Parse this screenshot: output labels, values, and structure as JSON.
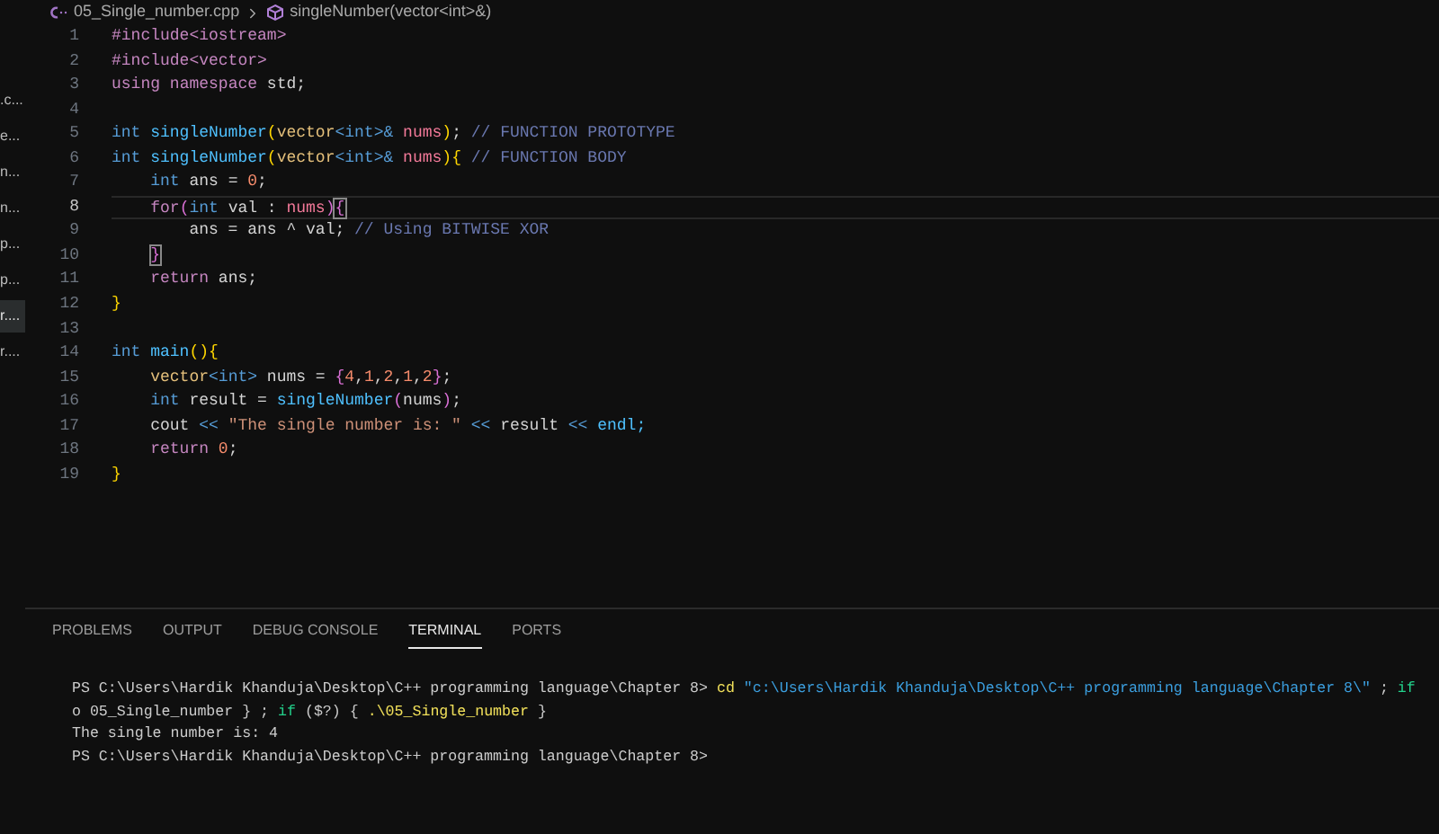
{
  "sidebar": {
    "items": [
      {
        "label": ".c...",
        "selected": false
      },
      {
        "label": "e...",
        "selected": false
      },
      {
        "label": "n...",
        "selected": false
      },
      {
        "label": "n...",
        "selected": false
      },
      {
        "label": "p...",
        "selected": false
      },
      {
        "label": "p...",
        "selected": false
      },
      {
        "label": "r....",
        "selected": true
      },
      {
        "label": "r....",
        "selected": false
      }
    ]
  },
  "breadcrumb": {
    "file": "05_Single_number.cpp",
    "symbol": "singleNumber(vector<int>&)"
  },
  "editor": {
    "lines": [
      {
        "number": "1",
        "current": false,
        "tokens": [
          {
            "text": "#include<iostream>",
            "kind": "preproc"
          }
        ]
      },
      {
        "number": "2",
        "current": false,
        "tokens": [
          {
            "text": "#include<vector>",
            "kind": "preproc"
          }
        ]
      },
      {
        "number": "3",
        "current": false,
        "tokens": [
          {
            "text": "using",
            "kind": "control"
          },
          {
            "text": " namespace",
            "kind": "control"
          },
          {
            "text": " std;",
            "kind": "plain"
          }
        ]
      },
      {
        "number": "4",
        "current": false
      },
      {
        "number": "5",
        "current": false,
        "tokens": [
          {
            "text": "int",
            "kind": "keyword"
          },
          {
            "text": " singleNumber",
            "kind": "func"
          },
          {
            "text": "(",
            "kind": "bracket"
          },
          {
            "text": "vector",
            "kind": "type"
          },
          {
            "text": "<int>&",
            "kind": "keyword"
          },
          {
            "text": " nums",
            "kind": "param"
          },
          {
            "text": ")",
            "kind": "bracket"
          },
          {
            "text": "; ",
            "kind": "plain"
          },
          {
            "text": "// FUNCTION PROTOTYPE",
            "kind": "comment"
          }
        ]
      },
      {
        "number": "6",
        "current": false,
        "tokens": [
          {
            "text": "int",
            "kind": "keyword"
          },
          {
            "text": " singleNumber",
            "kind": "func"
          },
          {
            "text": "(",
            "kind": "bracket"
          },
          {
            "text": "vector",
            "kind": "type"
          },
          {
            "text": "<int>&",
            "kind": "keyword"
          },
          {
            "text": " nums",
            "kind": "param"
          },
          {
            "text": ")",
            "kind": "bracket"
          },
          {
            "text": "{",
            "kind": "bracket"
          },
          {
            "text": " // FUNCTION BODY",
            "kind": "comment"
          }
        ]
      },
      {
        "number": "7",
        "current": false,
        "tokens": [
          {
            "text": "    int",
            "kind": "keyword"
          },
          {
            "text": " ans = ",
            "kind": "plain"
          },
          {
            "text": "0",
            "kind": "number"
          },
          {
            "text": ";",
            "kind": "plain"
          }
        ]
      },
      {
        "number": "8",
        "current": true,
        "tokens": [
          {
            "text": "    for",
            "kind": "control"
          },
          {
            "text": "(",
            "kind": "bracket2"
          },
          {
            "text": "int",
            "kind": "keyword"
          },
          {
            "text": " val : ",
            "kind": "plain"
          },
          {
            "text": "nums",
            "kind": "param"
          },
          {
            "text": ")",
            "kind": "bracket2"
          },
          {
            "text": "{",
            "kind": "match"
          }
        ]
      },
      {
        "number": "9",
        "current": false,
        "tokens": [
          {
            "text": "        ans = ans ^ val; ",
            "kind": "plain"
          },
          {
            "text": "// Using BITWISE XOR",
            "kind": "comment"
          }
        ]
      },
      {
        "number": "10",
        "current": false,
        "tokens": [
          {
            "text": "}",
            "kind": "match"
          }
        ]
      },
      {
        "number": "11",
        "current": false,
        "tokens": [
          {
            "text": "    return",
            "kind": "control"
          },
          {
            "text": " ans;",
            "kind": "plain"
          }
        ]
      },
      {
        "number": "12",
        "current": false,
        "tokens": [
          {
            "text": "}",
            "kind": "bracket"
          }
        ]
      },
      {
        "number": "13",
        "current": false
      },
      {
        "number": "14",
        "current": false,
        "tokens": [
          {
            "text": "int",
            "kind": "keyword"
          },
          {
            "text": " main",
            "kind": "func"
          },
          {
            "text": "(){",
            "kind": "bracket"
          }
        ]
      },
      {
        "number": "15",
        "current": false,
        "tokens": [
          {
            "text": "    vector",
            "kind": "type"
          },
          {
            "text": "<int>",
            "kind": "keyword"
          },
          {
            "text": " nums = ",
            "kind": "plain"
          },
          {
            "text": "{",
            "kind": "bracket2"
          },
          {
            "text": "4",
            "kind": "number"
          },
          {
            "text": ",",
            "kind": "plain"
          },
          {
            "text": "1",
            "kind": "number"
          },
          {
            "text": ",",
            "kind": "plain"
          },
          {
            "text": "2",
            "kind": "number"
          },
          {
            "text": ",",
            "kind": "plain"
          },
          {
            "text": "1",
            "kind": "number"
          },
          {
            "text": ",",
            "kind": "plain"
          },
          {
            "text": "2",
            "kind": "number"
          },
          {
            "text": "}",
            "kind": "bracket2"
          },
          {
            "text": ";",
            "kind": "plain"
          }
        ]
      },
      {
        "number": "16",
        "current": false,
        "tokens": [
          {
            "text": "    int",
            "kind": "keyword"
          },
          {
            "text": " result = ",
            "kind": "plain"
          },
          {
            "text": "singleNumber",
            "kind": "func"
          },
          {
            "text": "(",
            "kind": "bracket2"
          },
          {
            "text": "nums",
            "kind": "plain"
          },
          {
            "text": ")",
            "kind": "bracket2"
          },
          {
            "text": ";",
            "kind": "plain"
          }
        ]
      },
      {
        "number": "17",
        "current": false,
        "tokens": [
          {
            "text": "    cout ",
            "kind": "plain"
          },
          {
            "text": "<<",
            "kind": "keyword"
          },
          {
            "text": " \"The single number is: \" ",
            "kind": "string"
          },
          {
            "text": "<<",
            "kind": "keyword"
          },
          {
            "text": " result ",
            "kind": "plain"
          },
          {
            "text": "<<",
            "kind": "keyword"
          },
          {
            "text": " endl;",
            "kind": "func"
          }
        ]
      },
      {
        "number": "18",
        "current": false,
        "tokens": [
          {
            "text": "    return",
            "kind": "control"
          },
          {
            "text": " 0",
            "kind": "number"
          },
          {
            "text": ";",
            "kind": "plain"
          }
        ]
      },
      {
        "number": "19",
        "current": false,
        "tokens": [
          {
            "text": "}",
            "kind": "bracket"
          }
        ]
      }
    ]
  },
  "panel": {
    "tabs": [
      {
        "label": "PROBLEMS",
        "selected": false
      },
      {
        "label": "OUTPUT",
        "selected": false
      },
      {
        "label": "DEBUG CONSOLE",
        "selected": false
      },
      {
        "label": "TERMINAL",
        "selected": true
      },
      {
        "label": "PORTS",
        "selected": false
      }
    ],
    "terminal": [
      [
        {
          "text": "PS C:\\Users\\Hardik Khanduja\\Desktop\\C++ programming language\\Chapter 8> ",
          "kind": "plain"
        },
        {
          "text": "cd",
          "kind": "command"
        },
        {
          "text": " \"c:\\Users\\Hardik Khanduja\\Desktop\\C++ programming language\\Chapter 8\\\"",
          "kind": "argument"
        },
        {
          "text": " ; ",
          "kind": "plain"
        },
        {
          "text": "if",
          "kind": "keyword"
        }
      ],
      [
        {
          "text": "o 05_Single_number } ; ",
          "kind": "plain"
        },
        {
          "text": "if",
          "kind": "keyword"
        },
        {
          "text": " ($?) { ",
          "kind": "plain"
        },
        {
          "text": ".\\05_Single_number",
          "kind": "command"
        },
        {
          "text": " }",
          "kind": "plain"
        }
      ],
      [
        {
          "text": "The single number is: 4",
          "kind": "plain"
        }
      ],
      [
        {
          "text": "PS C:\\Users\\Hardik Khanduja\\Desktop\\C++ programming language\\Chapter 8>",
          "kind": "plain"
        }
      ]
    ]
  }
}
